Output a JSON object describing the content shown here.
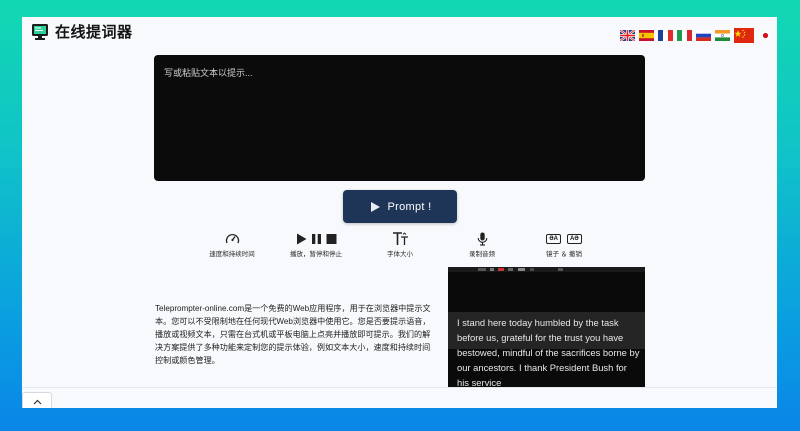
{
  "header": {
    "title": "在线提词器",
    "logo_icon": "monitor-logo-icon",
    "flags": [
      "uk-flag",
      "spain-flag",
      "france-flag",
      "italy-flag",
      "russia-flag",
      "india-flag",
      "china-flag",
      "japan-flag"
    ]
  },
  "editor": {
    "placeholder": "写或粘贴文本以提示..."
  },
  "prompt_button": {
    "label": "Prompt !",
    "icon": "play-icon"
  },
  "features": [
    {
      "label": "速度和持续时间",
      "icon": "speedometer-icon"
    },
    {
      "label": "播放，暂停和停止",
      "icons": [
        "play-icon",
        "pause-icon",
        "stop-icon"
      ]
    },
    {
      "label": "字体大小",
      "icon": "font-size-icon"
    },
    {
      "label": "录制音频",
      "icon": "microphone-icon"
    },
    {
      "label": "镜子 ＆ 撤销",
      "icons": [
        "mirror-text-icon",
        "mirror-flip-icon"
      ],
      "mirror_texts": [
        "ƏA",
        "AƏ"
      ]
    }
  ],
  "description": "Teleprompter-online.com是一个免费的Web应用程序，用于在浏览器中提示文本。您可以不受限制地在任何现代Web浏览器中使用它。您是否要提示语音，播放或视频文本，只需在台式机或平板电脑上点亮并播放即可提示。我们的解决方案提供了多种功能来定制您的提示体验，例如文本大小，速度和持续时间控制或颜色管理。",
  "preview": {
    "text": "I stand here today humbled by the task before us, grateful for the trust you have bestowed, mindful of the sacrifices borne by our ancestors. I thank President Bush for his service"
  },
  "colors": {
    "button_bg": "#1f3558",
    "editor_bg": "#0b0b0b",
    "page_bg": "#f7f9fc",
    "gradient_top": "#12d8b2",
    "gradient_bottom": "#0a86e8"
  }
}
